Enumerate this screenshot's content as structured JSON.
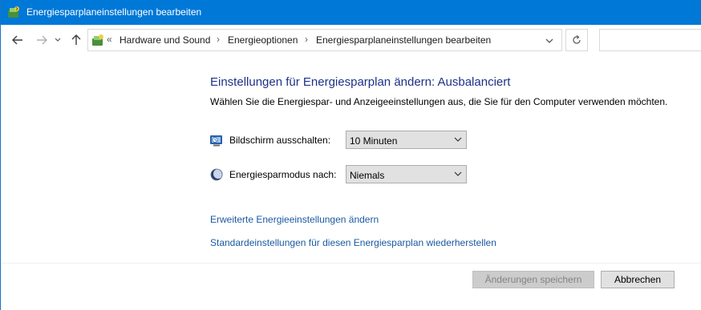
{
  "window": {
    "title": "Energiesparplaneinstellungen bearbeiten",
    "icon": "power-options-icon"
  },
  "nav": {
    "back_icon": "arrow-left-icon",
    "forward_icon": "arrow-right-icon",
    "recent_icon": "chevron-down-icon",
    "up_icon": "arrow-up-icon",
    "refresh_icon": "refresh-icon"
  },
  "address": {
    "more": "«",
    "crumbs": [
      "Hardware und Sound",
      "Energieoptionen",
      "Energiesparplaneinstellungen bearbeiten"
    ],
    "separator": "›",
    "search_value": ""
  },
  "main": {
    "heading": "Einstellungen für Energiesparplan ändern: Ausbalanciert",
    "subtext": "Wählen Sie die Energiespar- und Anzeigeeinstellungen aus, die Sie für den Computer verwenden möchten.",
    "settings": [
      {
        "label": "Bildschirm ausschalten:",
        "value": "10 Minuten",
        "icon": "monitor-icon"
      },
      {
        "label": "Energiesparmodus nach:",
        "value": "Niemals",
        "icon": "moon-icon"
      }
    ],
    "links": [
      "Erweiterte Energieeinstellungen ändern",
      "Standardeinstellungen für diesen Energiesparplan wiederherstellen"
    ]
  },
  "buttons": {
    "save": "Änderungen speichern",
    "cancel": "Abbrechen"
  },
  "colors": {
    "titlebar": "#0078d7",
    "heading": "#1e3287",
    "link": "#1a5aa0"
  }
}
